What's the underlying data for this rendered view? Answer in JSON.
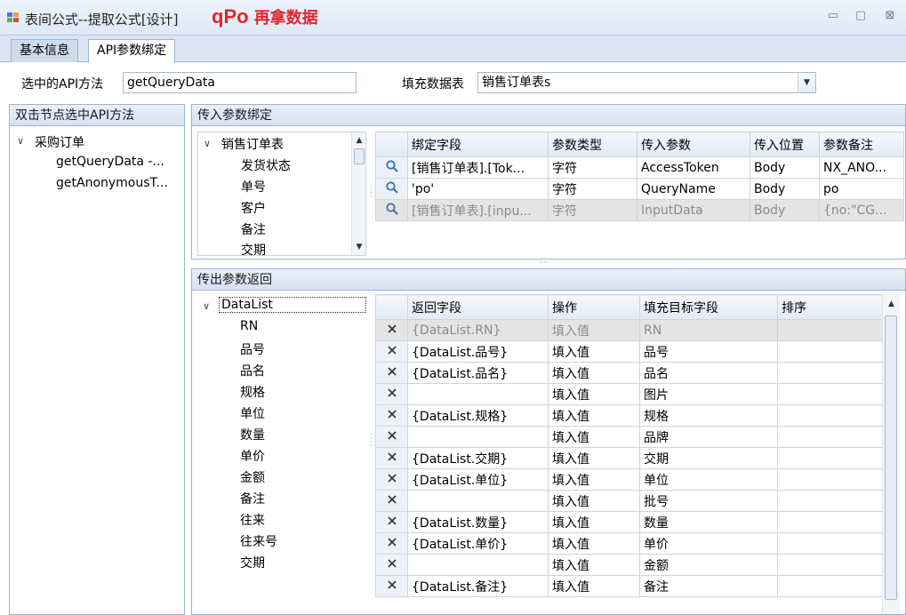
{
  "window": {
    "title": "表间公式--提取公式[设计]",
    "brand_latin": "qPo",
    "brand_cn": "再拿数据",
    "minimize": "▭",
    "maximize": "▢",
    "close": "⊠"
  },
  "tabs": [
    {
      "label": "基本信息"
    },
    {
      "label": "API参数绑定"
    }
  ],
  "toprow": {
    "api_label": "选中的API方法",
    "api_value": "getQueryData",
    "table_label": "填充数据表",
    "table_value": "销售订单表s"
  },
  "left_panel": {
    "header": "双击节点选中API方法",
    "root": "采购订单",
    "children": [
      "getQueryData -...",
      "getAnonymousT..."
    ]
  },
  "input_panel": {
    "header": "传入参数绑定",
    "tree_root": "销售订单表",
    "tree_items": [
      "发货状态",
      "单号",
      "客户",
      "备注",
      "交期"
    ],
    "columns": [
      "绑定字段",
      "参数类型",
      "传入参数",
      "传入位置",
      "参数备注"
    ],
    "rows": [
      {
        "field": "[销售订单表].[Tok...",
        "type": "字符",
        "param": "AccessToken",
        "pos": "Body",
        "note": "NX_ANO...",
        "dim": false
      },
      {
        "field": "'po'",
        "type": "字符",
        "param": "QueryName",
        "pos": "Body",
        "note": "po",
        "dim": false
      },
      {
        "field": "[销售订单表].[inpu...",
        "type": "字符",
        "param": "InputData",
        "pos": "Body",
        "note": "{no:\"CG...",
        "dim": true
      }
    ]
  },
  "output_panel": {
    "header": "传出参数返回",
    "tree_root": "DataList",
    "tree_items": [
      "RN",
      "品号",
      "品名",
      "规格",
      "单位",
      "数量",
      "单价",
      "金额",
      "备注",
      "往来",
      "往来号",
      "交期"
    ],
    "columns": [
      "返回字段",
      "操作",
      "填充目标字段",
      "排序"
    ],
    "rows": [
      {
        "ret": "{DataList.RN}",
        "op": "填入值",
        "target": "RN",
        "dim": true
      },
      {
        "ret": "{DataList.品号}",
        "op": "填入值",
        "target": "品号",
        "dim": false
      },
      {
        "ret": "{DataList.品名}",
        "op": "填入值",
        "target": "品名",
        "dim": false
      },
      {
        "ret": "",
        "op": "填入值",
        "target": "图片",
        "dim": false
      },
      {
        "ret": "{DataList.规格}",
        "op": "填入值",
        "target": "规格",
        "dim": false
      },
      {
        "ret": "",
        "op": "填入值",
        "target": "品牌",
        "dim": false
      },
      {
        "ret": "{DataList.交期}",
        "op": "填入值",
        "target": "交期",
        "dim": false
      },
      {
        "ret": "{DataList.单位}",
        "op": "填入值",
        "target": "单位",
        "dim": false
      },
      {
        "ret": "",
        "op": "填入值",
        "target": "批号",
        "dim": false
      },
      {
        "ret": "{DataList.数量}",
        "op": "填入值",
        "target": "数量",
        "dim": false
      },
      {
        "ret": "{DataList.单价}",
        "op": "填入值",
        "target": "单价",
        "dim": false
      },
      {
        "ret": "",
        "op": "填入值",
        "target": "金额",
        "dim": false
      },
      {
        "ret": "{DataList.备注}",
        "op": "填入值",
        "target": "备注",
        "dim": false
      }
    ]
  },
  "icons": {
    "search": "search-icon",
    "delete": "delete-x-icon"
  },
  "colors": {
    "brand": "#e0262f",
    "header_bg": "#dbe5f3",
    "border": "#9fb3cf"
  }
}
